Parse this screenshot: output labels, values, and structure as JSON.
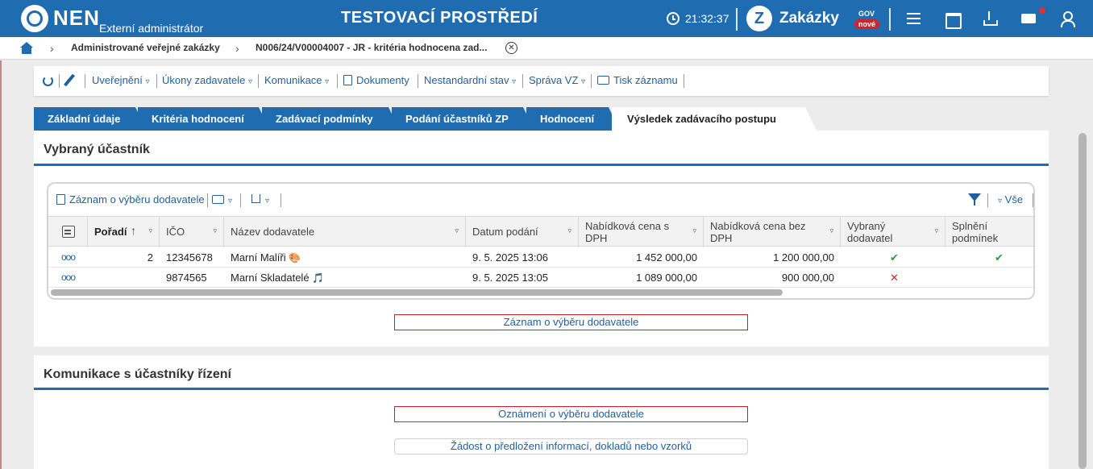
{
  "header": {
    "logo_text": "NEN",
    "role": "Externí administrátor",
    "environment": "TESTOVACÍ PROSTŘEDÍ",
    "time": "21:32:37",
    "zakazky_logo_letter": "Z",
    "zakazky_title": "Zakázky",
    "zakazky_gov": "GOV",
    "zakazky_badge": "nové",
    "icons": [
      "menu-icon",
      "calendar-icon",
      "download-icon",
      "mail-icon",
      "user-icon"
    ]
  },
  "breadcrumb": {
    "items": [
      "Administrované veřejné zakázky",
      "N006/24/V00004007 - JR - kritéria hodnocena zad..."
    ],
    "close_label": "✕",
    "chevron": "›"
  },
  "toolbar": {
    "uverejneni": "Uveřejnění",
    "ukony": "Úkony zadavatele",
    "komunikace": "Komunikace",
    "dokumenty": "Dokumenty",
    "nestandardni": "Nestandardní stav",
    "sprava": "Správa VZ",
    "tisk": "Tisk záznamu",
    "dropdown_marker": "▿"
  },
  "tabs": [
    {
      "label": "Základní údaje",
      "active": false
    },
    {
      "label": "Kritéria hodnocení",
      "active": false
    },
    {
      "label": "Zadávací podmínky",
      "active": false
    },
    {
      "label": "Podání účastníků ZP",
      "active": false
    },
    {
      "label": "Hodnocení",
      "active": false
    },
    {
      "label": "Výsledek zadávacího postupu",
      "active": true
    }
  ],
  "selected_section": {
    "title": "Vybraný účastník",
    "grid_toolbar": {
      "record_label": "Záznam o výběru dodavatele",
      "filter_all": "Vše",
      "dropdown_marker": "▿"
    },
    "columns": [
      {
        "label": "Pořadí",
        "sort": "↑"
      },
      {
        "label": "IČO"
      },
      {
        "label": "Název dodavatele"
      },
      {
        "label": "Datum podání"
      },
      {
        "label": "Nabídková cena s DPH"
      },
      {
        "label": "Nabídková cena bez DPH"
      },
      {
        "label": "Vybraný dodavatel"
      },
      {
        "label": "Splnění podmínek"
      }
    ],
    "rows": [
      {
        "menu": "ooo",
        "poradi": "2",
        "ico": "12345678",
        "nazev": "Marní Malíři",
        "nazev_icon": "🎨",
        "datum": "9. 5. 2025 13:06",
        "cena_s_dph": "1 452 000,00",
        "cena_bez_dph": "1 200 000,00",
        "vybrany": "✔",
        "splneni": "✔"
      },
      {
        "menu": "ooo",
        "poradi": "",
        "ico": "9874565",
        "nazev": "Marní Skladatelé",
        "nazev_icon": "🎵",
        "datum": "9. 5. 2025 13:05",
        "cena_s_dph": "1 089 000,00",
        "cena_bez_dph": "900 000,00",
        "vybrany": "✕",
        "splneni": ""
      }
    ],
    "action_button": "Záznam o výběru dodavatele"
  },
  "communication_section": {
    "title": "Komunikace s účastníky řízení",
    "buttons": [
      "Oznámení o výběru dodavatele",
      "Žádost o předložení informací, dokladů nebo vzorků"
    ]
  },
  "colors": {
    "brand_blue": "#1f6cb0",
    "link_blue": "#1f5f9e",
    "alert_red": "#c9202a",
    "check_green": "#2e9a3a"
  }
}
